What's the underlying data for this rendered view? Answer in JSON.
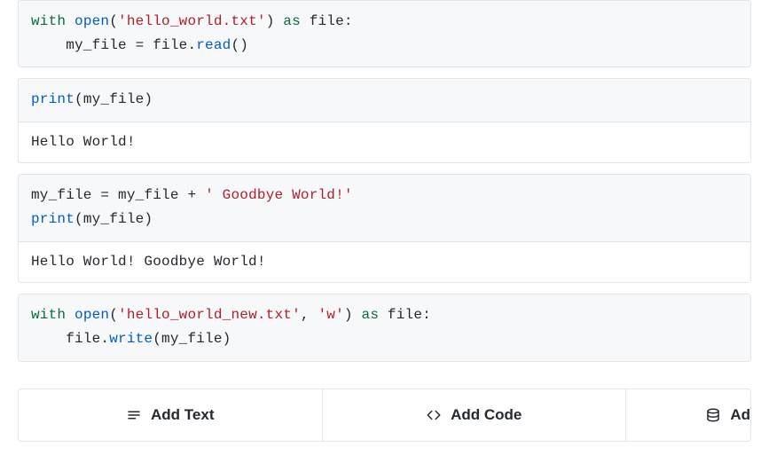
{
  "cells": [
    {
      "tokens": [
        [
          {
            "t": "with ",
            "c": "kw"
          },
          {
            "t": "open",
            "c": "builtin"
          },
          {
            "t": "(",
            "c": "id"
          },
          {
            "t": "'hello_world.txt'",
            "c": "str"
          },
          {
            "t": ") ",
            "c": "id"
          },
          {
            "t": "as",
            "c": "kw"
          },
          {
            "t": " file:",
            "c": "id"
          }
        ],
        [
          {
            "t": "    my_file ",
            "c": "id"
          },
          {
            "t": "=",
            "c": "id"
          },
          {
            "t": " file.",
            "c": "id"
          },
          {
            "t": "read",
            "c": "attr"
          },
          {
            "t": "()",
            "c": "id"
          }
        ]
      ],
      "output": null
    },
    {
      "tokens": [
        [
          {
            "t": "print",
            "c": "builtin"
          },
          {
            "t": "(my_file)",
            "c": "id"
          }
        ]
      ],
      "output": "Hello World!"
    },
    {
      "tokens": [
        [
          {
            "t": "my_file ",
            "c": "id"
          },
          {
            "t": "=",
            "c": "id"
          },
          {
            "t": " my_file ",
            "c": "id"
          },
          {
            "t": "+",
            "c": "id"
          },
          {
            "t": " ",
            "c": "id"
          },
          {
            "t": "' Goodbye World!'",
            "c": "str"
          }
        ],
        [
          {
            "t": "print",
            "c": "builtin"
          },
          {
            "t": "(my_file)",
            "c": "id"
          }
        ]
      ],
      "output": "Hello World! Goodbye World!"
    },
    {
      "tokens": [
        [
          {
            "t": "with ",
            "c": "kw"
          },
          {
            "t": "open",
            "c": "builtin"
          },
          {
            "t": "(",
            "c": "id"
          },
          {
            "t": "'hello_world_new.txt'",
            "c": "str"
          },
          {
            "t": ", ",
            "c": "id"
          },
          {
            "t": "'w'",
            "c": "str"
          },
          {
            "t": ") ",
            "c": "id"
          },
          {
            "t": "as",
            "c": "kw"
          },
          {
            "t": " file:",
            "c": "id"
          }
        ],
        [
          {
            "t": "    file.",
            "c": "id"
          },
          {
            "t": "write",
            "c": "attr"
          },
          {
            "t": "(my_file)",
            "c": "id"
          }
        ]
      ],
      "output": null
    }
  ],
  "toolbar": {
    "add_text": "Add Text",
    "add_code": "Add Code",
    "add_other": "Ad"
  }
}
